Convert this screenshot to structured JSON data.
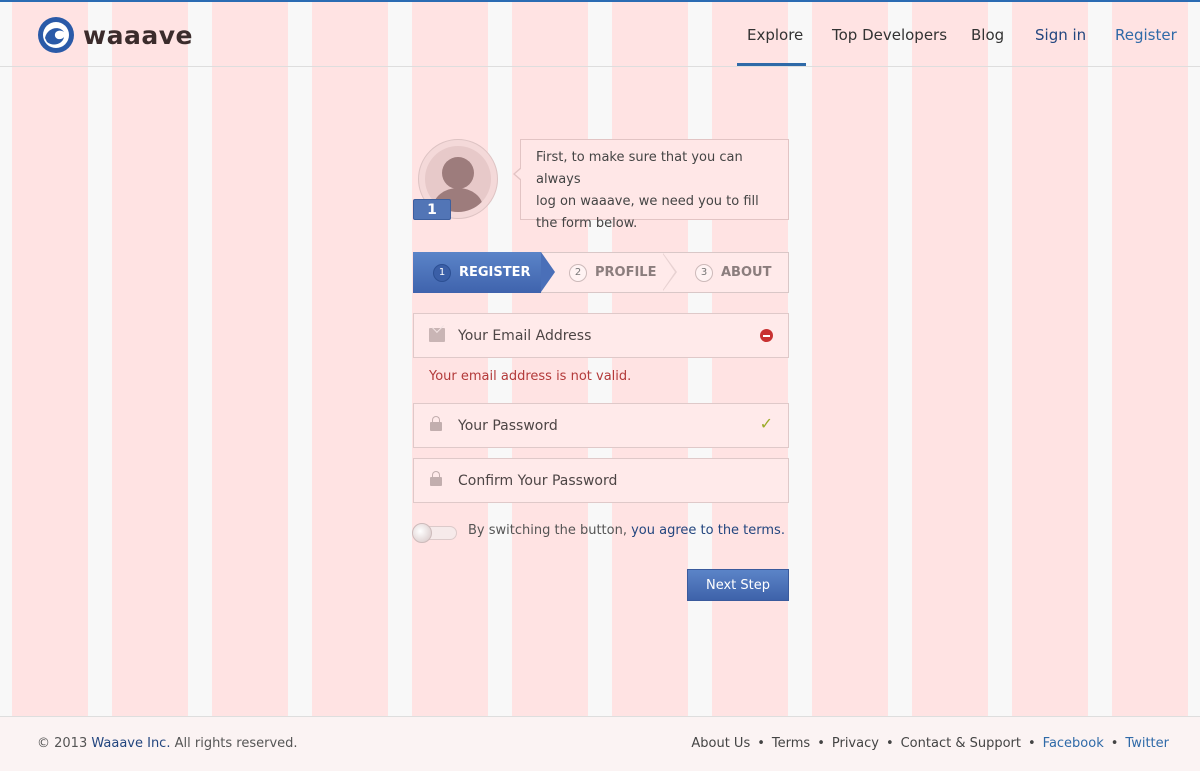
{
  "brand": {
    "name": "waaave"
  },
  "nav": {
    "items": [
      {
        "label": "Explore"
      },
      {
        "label": "Top Developers"
      },
      {
        "label": "Blog"
      },
      {
        "label": "Sign in"
      },
      {
        "label": "Register"
      }
    ]
  },
  "intro": {
    "step_badge": "1",
    "bubble_line1": "First, to make sure that you can always",
    "bubble_line2": "log on waaave, we need you to fill",
    "bubble_line3": "the form below."
  },
  "steps": [
    {
      "num": "1",
      "label": "REGISTER"
    },
    {
      "num": "2",
      "label": "PROFILE"
    },
    {
      "num": "3",
      "label": "ABOUT"
    }
  ],
  "form": {
    "email_placeholder": "Your Email Address",
    "email_error": "Your email address is not valid.",
    "password_placeholder": "Your Password",
    "confirm_placeholder": "Confirm Your Password",
    "terms_text": "By switching the button,",
    "terms_link": "you agree to the terms.",
    "submit_label": "Next Step"
  },
  "footer": {
    "copyright": "© 2013",
    "company": "Waaave Inc.",
    "rights": "All rights reserved.",
    "links": [
      "About Us",
      "Terms",
      "Privacy",
      "Contact & Support",
      "Facebook",
      "Twitter"
    ]
  },
  "colors": {
    "accent": "#2f6aa8",
    "step_active": "#4a6fb8",
    "error": "#c83131",
    "success": "#9bab28",
    "grid_overlay": "#ffe3e3"
  }
}
